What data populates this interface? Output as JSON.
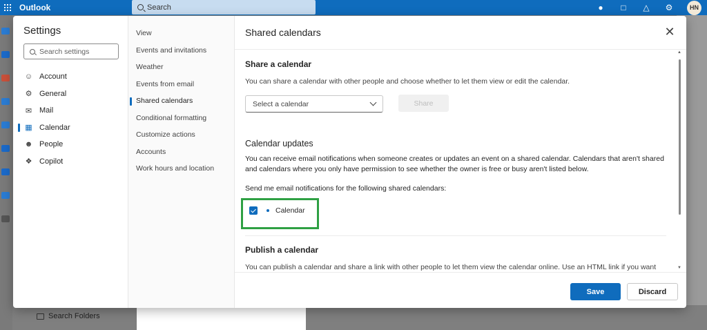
{
  "app": {
    "name": "Outlook",
    "search_placeholder": "Search",
    "user_initials": "HN",
    "search_folders": "Search Folders"
  },
  "settings": {
    "title": "Settings",
    "search_placeholder": "Search settings",
    "categories": [
      {
        "label": "Account",
        "icon": "person-icon"
      },
      {
        "label": "General",
        "icon": "gear-icon"
      },
      {
        "label": "Mail",
        "icon": "mail-icon"
      },
      {
        "label": "Calendar",
        "icon": "calendar-icon",
        "active": true
      },
      {
        "label": "People",
        "icon": "people-icon"
      },
      {
        "label": "Copilot",
        "icon": "copilot-icon"
      }
    ],
    "subcategories": [
      {
        "label": "View"
      },
      {
        "label": "Events and invitations"
      },
      {
        "label": "Weather"
      },
      {
        "label": "Events from email"
      },
      {
        "label": "Shared calendars",
        "active": true
      },
      {
        "label": "Conditional formatting"
      },
      {
        "label": "Customize actions"
      },
      {
        "label": "Accounts"
      },
      {
        "label": "Work hours and location"
      }
    ]
  },
  "pane": {
    "title": "Shared calendars",
    "share": {
      "heading": "Share a calendar",
      "description": "You can share a calendar with other people and choose whether to let them view or edit the calendar.",
      "select_placeholder": "Select a calendar",
      "button": "Share"
    },
    "updates": {
      "heading": "Calendar updates",
      "description": "You can receive email notifications when someone creates or updates an event on a shared calendar. Calendars that aren't shared and calendars where you only have permission to see whether the owner is free or busy aren't listed below.",
      "send_label": "Send me email notifications for the following shared calendars:",
      "calendars": [
        {
          "label": "Calendar",
          "checked": true
        }
      ]
    },
    "publish": {
      "heading": "Publish a calendar",
      "description": "You can publish a calendar and share a link with other people to let them view the calendar online. Use an HTML link if you want"
    },
    "save_label": "Save",
    "discard_label": "Discard"
  },
  "colors": {
    "accent": "#0f6cbd",
    "highlight": "#2ea043"
  }
}
